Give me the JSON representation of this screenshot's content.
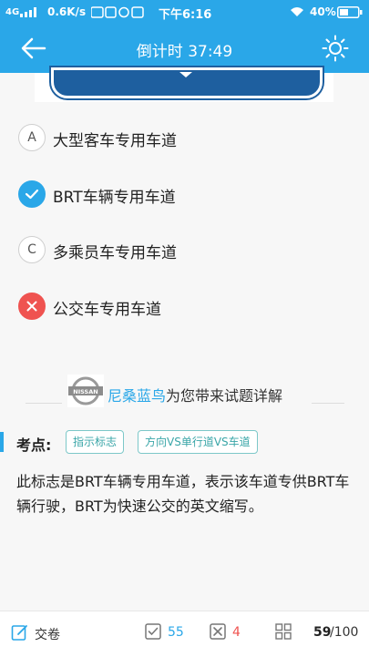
{
  "status_bar": {
    "network": "4G",
    "speed": "0.6K/s",
    "time": "下午6:16",
    "battery": "40%"
  },
  "header": {
    "title": "倒计时 37:49"
  },
  "options": [
    {
      "letter": "A",
      "text": "大型客车专用车道",
      "state": "normal"
    },
    {
      "letter": "",
      "text": "BRT车辆专用车道",
      "state": "correct"
    },
    {
      "letter": "C",
      "text": "多乘员车专用车道",
      "state": "normal"
    },
    {
      "letter": "",
      "text": "公交车专用车道",
      "state": "wrong"
    }
  ],
  "explanation": {
    "sponsor_logo_text": "NISSAN",
    "sponsor_brand": "尼桑蓝鸟",
    "sponsor_text": "为您带来试题详解",
    "key_point_label": "考点:",
    "tags": [
      "指示标志",
      "方向VS单行道VS车道"
    ],
    "description": "此标志是BRT车辆专用车道，表示该车道专供BRT车辆行驶，BRT为快速公交的英文缩写。"
  },
  "bottom_bar": {
    "submit_label": "交卷",
    "correct_count": "55",
    "wrong_count": "4",
    "progress_current": "59",
    "progress_total": "/100"
  },
  "colors": {
    "primary": "#2aa7e8",
    "wrong": "#ef5350",
    "tag": "#3aa6a8"
  }
}
